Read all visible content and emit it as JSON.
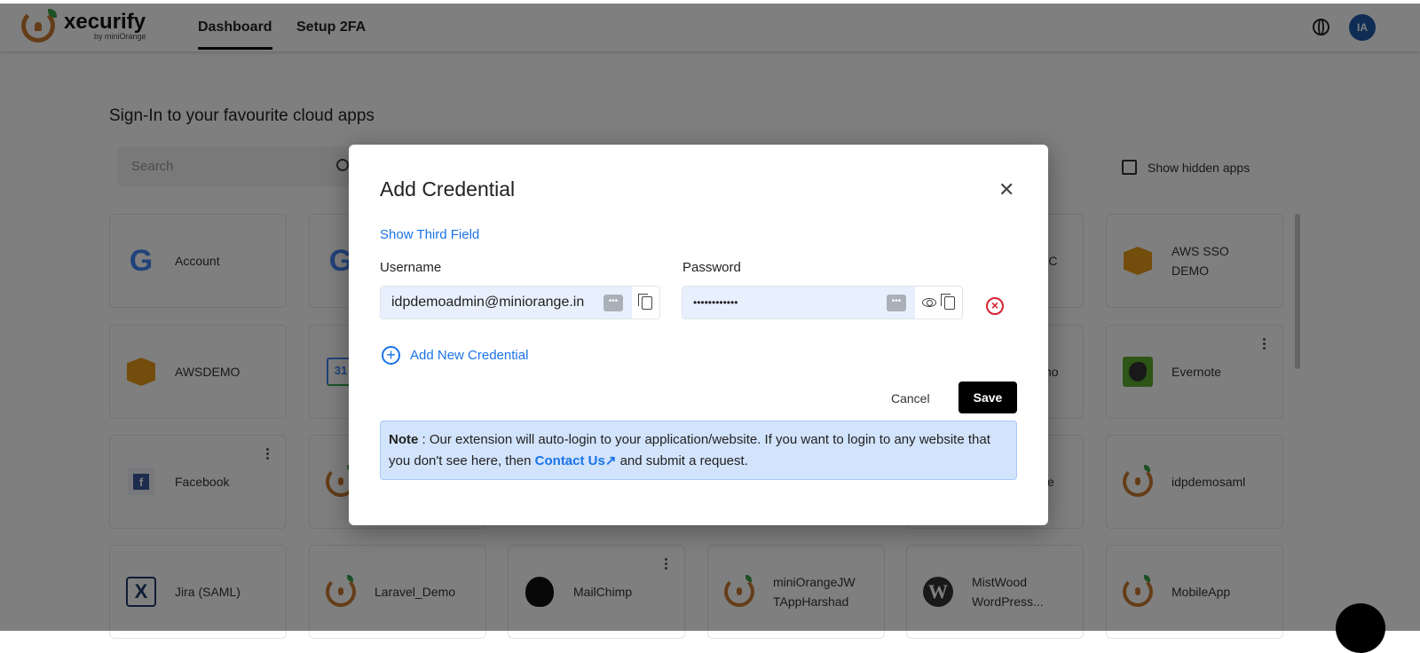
{
  "header": {
    "brand": "xecurify",
    "brand_sub": "by miniOrange",
    "nav": [
      "Dashboard",
      "Setup 2FA"
    ],
    "avatar": "IA"
  },
  "main": {
    "heading": "Sign-In to your favourite cloud apps",
    "search_placeholder": "Search",
    "show_hidden_apps": "Show hidden apps",
    "apps": [
      {
        "name": "Account",
        "icon": "google"
      },
      {
        "name": "",
        "icon": "google"
      },
      {
        "name": "AC",
        "icon": "unknown"
      },
      {
        "name": "AWS SSO DEMO",
        "icon": "aws"
      },
      {
        "name": "AWSDEMO",
        "icon": "aws"
      },
      {
        "name": "",
        "icon": "google-calendar"
      },
      {
        "name": "no",
        "icon": "unknown"
      },
      {
        "name": "Evernote",
        "icon": "evernote"
      },
      {
        "name": "Facebook",
        "icon": "facebook"
      },
      {
        "name": "",
        "icon": "miniorange"
      },
      {
        "name": "e",
        "icon": "unknown"
      },
      {
        "name": "idpdemosaml",
        "icon": "miniorange"
      },
      {
        "name": "Jira (SAML)",
        "icon": "jira"
      },
      {
        "name": "Laravel_Demo",
        "icon": "miniorange"
      },
      {
        "name": "MailChimp",
        "icon": "mailchimp"
      },
      {
        "name": "miniOrangeJWTAppHarshad",
        "icon": "miniorange"
      },
      {
        "name": "MistWood WordPress...",
        "icon": "wordpress"
      },
      {
        "name": "MobileApp",
        "icon": "miniorange"
      }
    ],
    "calendar_day": "31"
  },
  "modal": {
    "title": "Add Credential",
    "show_third_field": "Show Third Field",
    "username_label": "Username",
    "password_label": "Password",
    "username_value": "idpdemoadmin@miniorange.in",
    "password_value": "••••••••••••",
    "add_new": "Add New Credential",
    "cancel": "Cancel",
    "save": "Save",
    "note_label": "Note",
    "note_text1": " : Our extension will auto-login to your application/website. If you want to login to any website that you don't see here, then ",
    "contact_us": "Contact Us",
    "note_text2": " and submit a request."
  }
}
